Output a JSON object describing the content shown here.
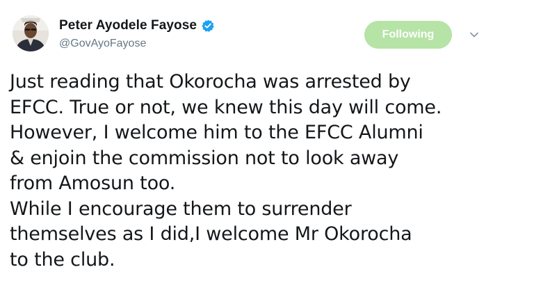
{
  "author": {
    "display_name": "Peter Ayodele Fayose",
    "handle": "@GovAyoFayose",
    "verified": true
  },
  "follow_button": {
    "label": "Following",
    "color": "#b6e3a6"
  },
  "menu": {
    "icon": "chevron-down-icon"
  },
  "tweet": {
    "text": "Just reading that Okorocha was arrested by\nEFCC. True or not, we knew this day will come.\nHowever, I welcome him to the EFCC Alumni\n& enjoin the commission not to look away\nfrom Amosun too.\nWhile I encourage them to surrender\nthemselves as I did,I welcome Mr Okorocha\nto the club."
  },
  "colors": {
    "verified_badge": "#1da1f2",
    "handle_text": "#657786",
    "body_text": "#14171a"
  }
}
